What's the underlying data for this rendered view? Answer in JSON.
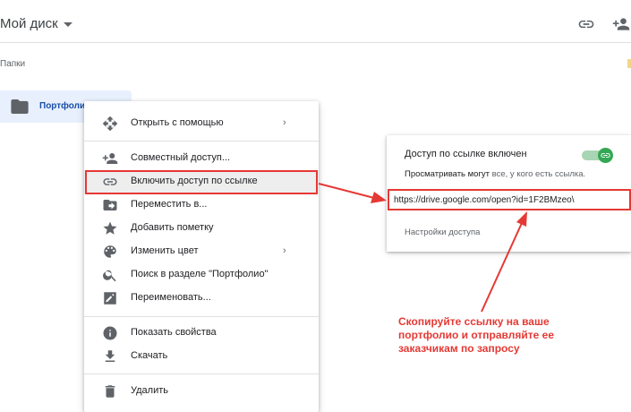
{
  "header": {
    "title": "Мой диск"
  },
  "section": {
    "folders_label": "Папки"
  },
  "folder": {
    "name": "Портфолио"
  },
  "context_menu": {
    "items": [
      {
        "label": "Открыть с помощью",
        "icon": "open-with-icon",
        "has_submenu": true
      },
      {
        "label": "Совместный доступ...",
        "icon": "person-add-icon"
      },
      {
        "label": "Включить доступ по ссылке",
        "icon": "link-icon",
        "highlighted": true
      },
      {
        "label": "Переместить в...",
        "icon": "folder-move-icon"
      },
      {
        "label": "Добавить пометку",
        "icon": "star-icon"
      },
      {
        "label": "Изменить цвет",
        "icon": "palette-icon",
        "has_submenu": true
      },
      {
        "label": "Поиск в разделе \"Портфолио\"",
        "icon": "search-icon"
      },
      {
        "label": "Переименовать...",
        "icon": "edit-icon"
      },
      {
        "label": "Показать свойства",
        "icon": "info-icon"
      },
      {
        "label": "Скачать",
        "icon": "download-icon"
      },
      {
        "label": "Удалить",
        "icon": "trash-icon"
      }
    ],
    "submenu_arrow": "›"
  },
  "share_card": {
    "title": "Доступ по ссылке включен",
    "subtitle_prefix": "Просматривать могут",
    "subtitle_muted": "все, у кого есть ссылка.",
    "link": "https://drive.google.com/open?id=1F2BMzeo\\",
    "settings": "Настройки доступа",
    "toggle_on": true
  },
  "annotation": {
    "lines": [
      "Скопируйте ссылку на ваше",
      "портфолио и отправляйте ее",
      "заказчикам по запросу"
    ]
  },
  "colors": {
    "annotation_red": "#e53935",
    "toggle_green": "#34a853",
    "folder_chip": "#e8f0fe",
    "folder_text": "#1a4ea7"
  }
}
